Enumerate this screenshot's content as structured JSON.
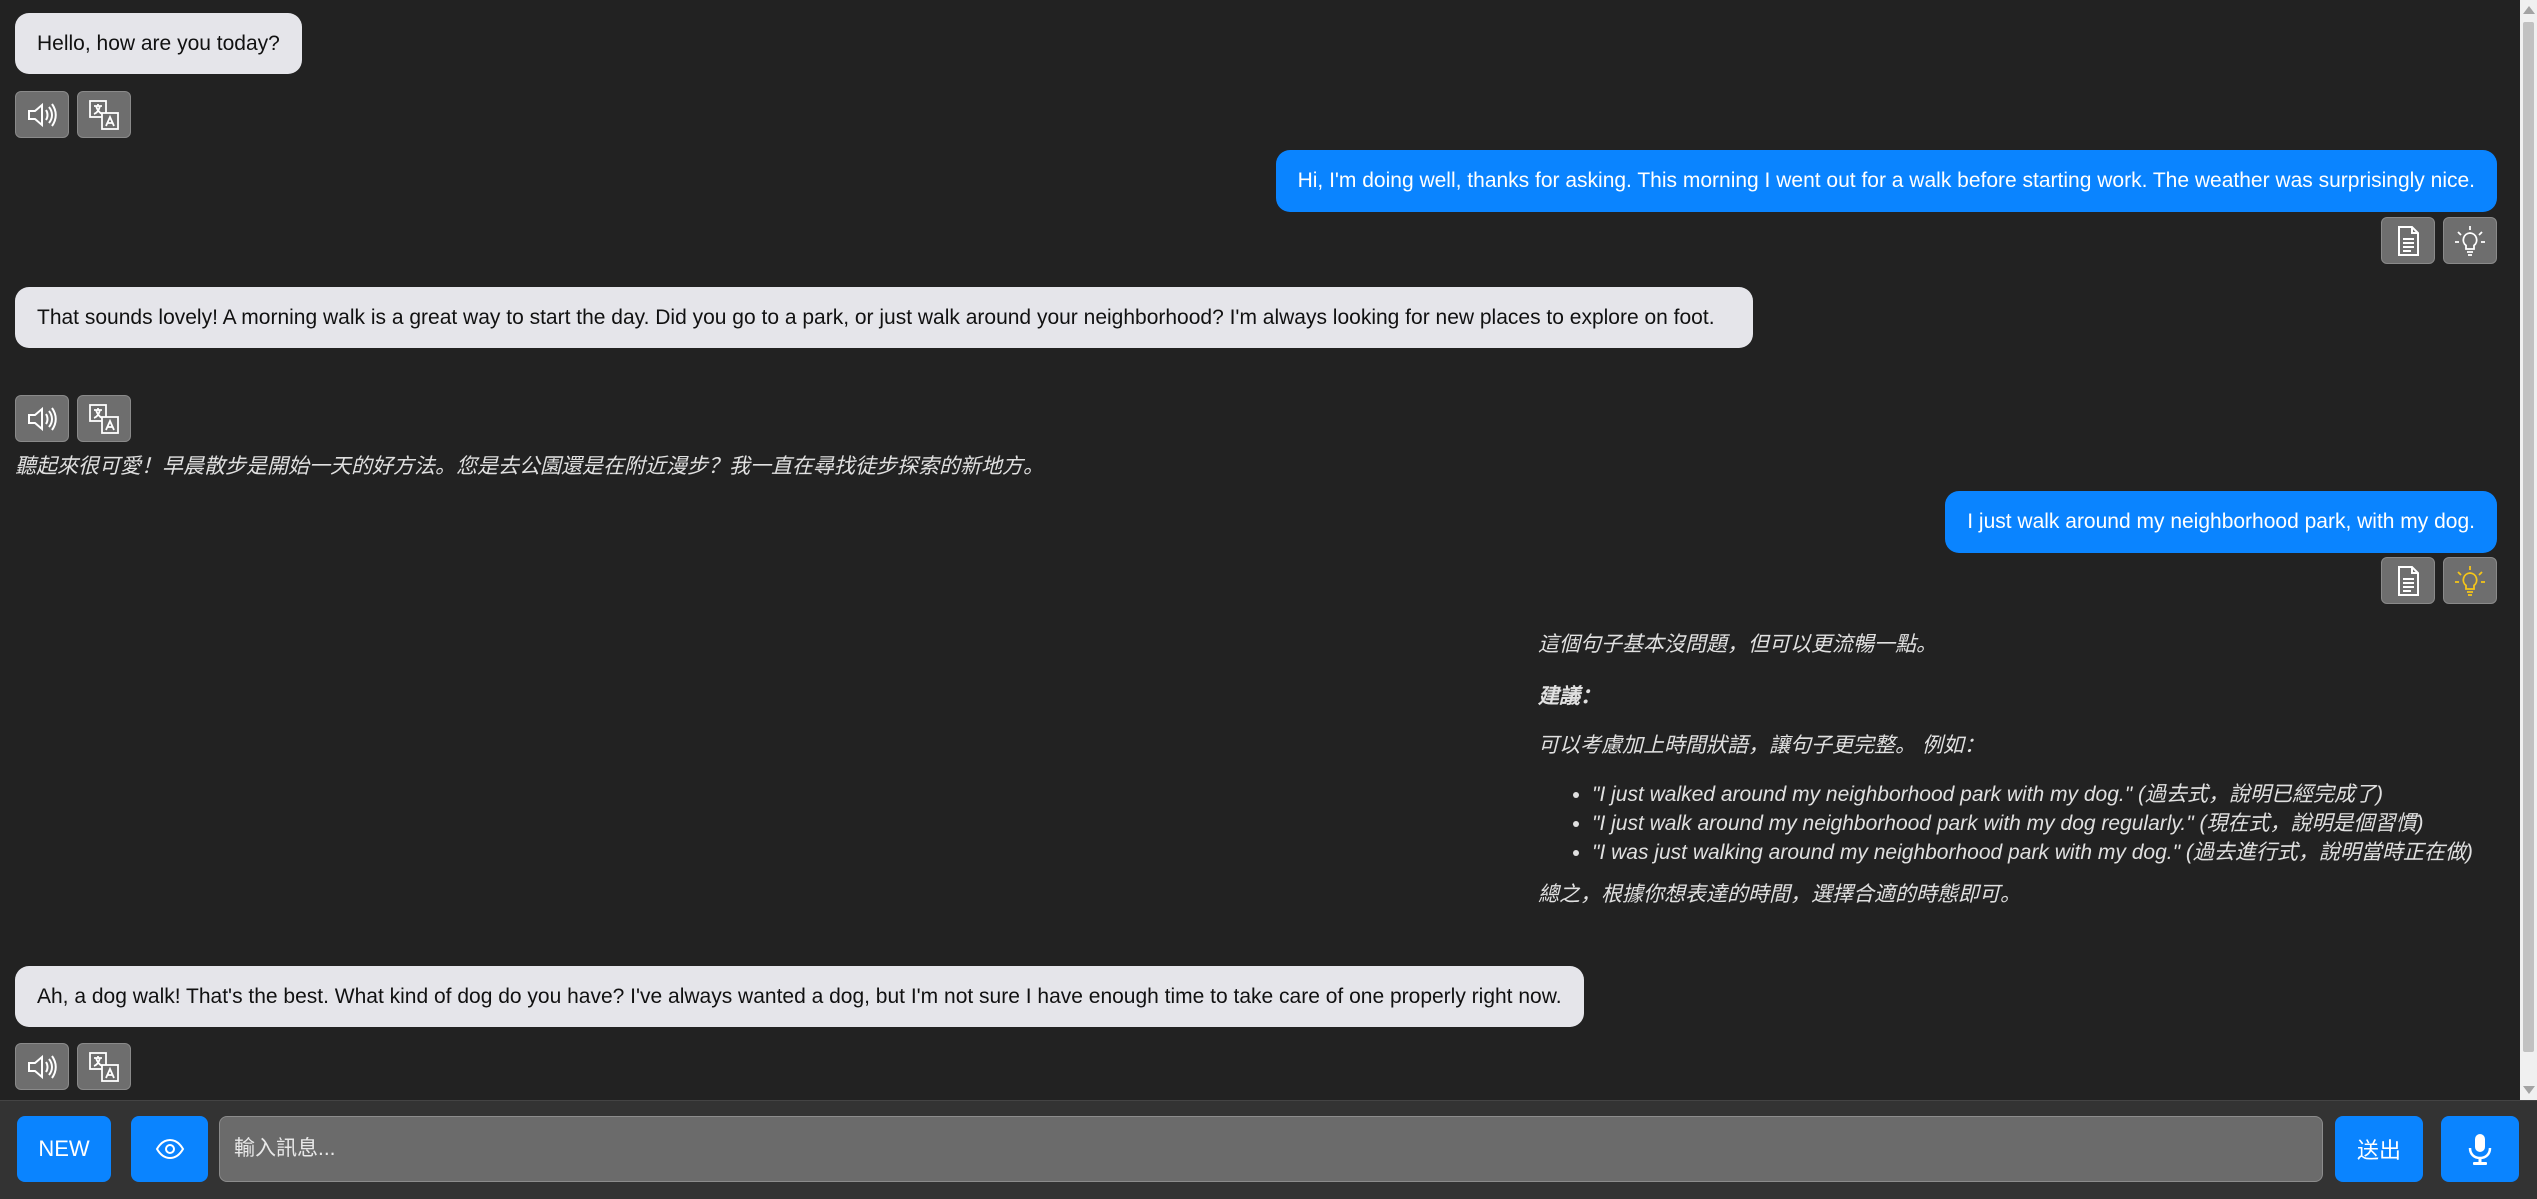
{
  "conversation": [
    {
      "role": "bot",
      "text": "Hello, how are you today?"
    },
    {
      "role": "user",
      "text": "Hi, I'm doing well, thanks for asking. This morning I went out for a walk before starting work. The weather was surprisingly nice."
    },
    {
      "role": "bot",
      "text": "That sounds lovely! A morning walk is a great way to start the day. Did you go to a park, or just walk around your neighborhood? I'm always looking for new places to explore on foot.",
      "translation": "聽起來很可愛！早晨散步是開始一天的好方法。您是去公園還是在附近漫步？我一直在尋找徒步探索的新地方。"
    },
    {
      "role": "user",
      "text": "I just walk around my neighborhood park, with my dog."
    },
    {
      "role": "bot",
      "text": "Ah, a dog walk! That's the best. What kind of dog do you have? I've always wanted a dog, but I'm not sure I have enough time to take care of one properly right now."
    }
  ],
  "feedback": {
    "intro": "這個句子基本沒問題，但可以更流暢一點。",
    "heading": "建議：",
    "lead": "可以考慮加上時間狀語，讓句子更完整。 例如：",
    "suggestions": [
      {
        "quote": "\"I just walked around my neighborhood park with my dog.\"",
        "note": " (過去式，說明已經完成了)"
      },
      {
        "quote": "\"I just walk around my neighborhood park with my dog regularly.\"",
        "note": " (現在式，說明是個習慣)"
      },
      {
        "quote": "\"I was just walking around my neighborhood park with my dog.\"",
        "note": " (過去進行式，說明當時正在做)"
      }
    ],
    "conclusion": "總之，根據你想表達的時間，選擇合適的時態即可。"
  },
  "icons": {
    "speak": "speaker-icon",
    "translate": "translate-icon",
    "copy": "document-icon",
    "hint": "lightbulb-icon",
    "hint_active_color": "#f5c518"
  },
  "bottom_bar": {
    "new_label": "NEW",
    "input_placeholder": "輸入訊息...",
    "send_label": "送出"
  },
  "colors": {
    "background": "#222222",
    "bot_bubble": "#e5e5ea",
    "user_bubble": "#0a84ff",
    "accent": "#0a84ff"
  }
}
